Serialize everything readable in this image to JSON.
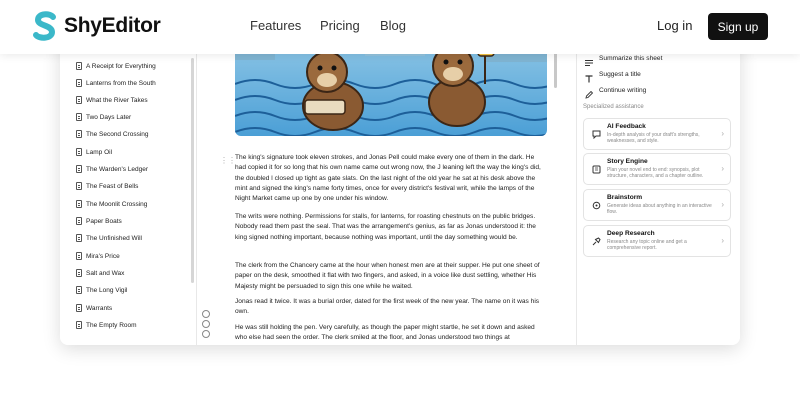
{
  "nav": {
    "brand": "ShyEditor",
    "links": [
      "Features",
      "Pricing",
      "Blog"
    ],
    "login": "Log in",
    "signup": "Sign up"
  },
  "sidebar": {
    "documents": [
      "A Receipt for Everything",
      "Lanterns from the South",
      "What the River Takes",
      "Two Days Later",
      "The Second Crossing",
      "Lamp Oil",
      "The Warden's Ledger",
      "The Feast of Bells",
      "The Moonlit Crossing",
      "Paper Boats",
      "The Unfinished Will",
      "Mira's Price",
      "Salt and Wax",
      "The Long Vigil",
      "Warrants",
      "The Empty Room"
    ]
  },
  "editor": {
    "paragraphs": [
      "The king's signature took eleven strokes, and Jonas Pell could make every one of them in the dark. He had copied it for so long that his own name came out wrong now, the J leaning left the way the king's did, the doubled l closed up tight as gate slats. On the last night of the old year he sat at his desk above the mint and signed the king's name forty times, once for every district's festival writ, while the lamps of the Night Market came up one by one under his window.",
      "The writs were nothing. Permissions for stalls, for lanterns, for roasting chestnuts on the public bridges. Nobody read them past the seal. That was the arrangement's genius, as far as Jonas understood it: the king signed nothing important, because nothing was important, until the day something would be.",
      "The clerk from the Chancery came at the hour when honest men are at their supper. He put one sheet of paper on the desk, smoothed it flat with two fingers, and asked, in a voice like dust settling, whether His Majesty might be persuaded to sign this one while he waited.",
      "Jonas read it twice. It was a burial order, dated for the first week of the new year. The name on it was his own.",
      "He was still holding the pen. Very carefully, as though the paper might startle, he set it down and asked who else had seen the order. The clerk smiled at the floor, and Jonas understood two things at"
    ]
  },
  "assistant": {
    "quick_actions": [
      "Summarize this sheet",
      "Suggest a title",
      "Continue writing"
    ],
    "section_title": "Specialized assistance",
    "tools": [
      {
        "title": "AI Feedback",
        "desc": "In-depth analysis of your draft's strengths, weaknesses, and style.",
        "icon": "feedback-icon"
      },
      {
        "title": "Story Engine",
        "desc": "Plan your novel end to end: synopsis, plot structure, characters, and a chapter outline.",
        "icon": "story-engine-icon"
      },
      {
        "title": "Brainstorm",
        "desc": "Generate ideas about anything in an interactive flow.",
        "icon": "brainstorm-icon"
      },
      {
        "title": "Deep Research",
        "desc": "Research any topic online and get a comprehensive report.",
        "icon": "research-icon"
      }
    ]
  },
  "colors": {
    "brand_teal": "#3bb8c9",
    "primary_button": "#111111",
    "water": "#2d7fc4"
  }
}
